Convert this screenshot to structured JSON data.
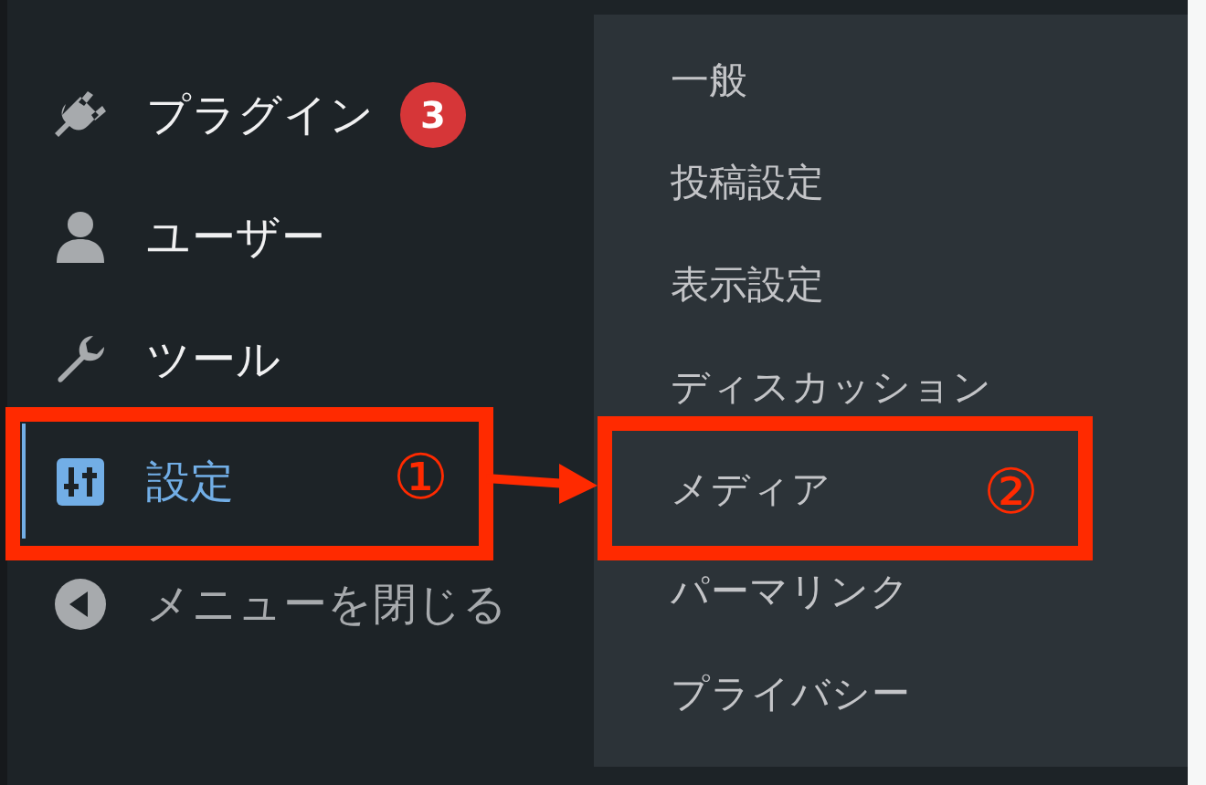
{
  "sidebar": {
    "items": [
      {
        "label": "プラグイン",
        "badge": "3",
        "selected": false
      },
      {
        "label": "ユーザー",
        "selected": false
      },
      {
        "label": "ツール",
        "selected": false
      },
      {
        "label": "設定",
        "selected": true,
        "annotation": "①"
      },
      {
        "label": "メニューを閉じる",
        "selected": false
      }
    ]
  },
  "submenu": {
    "items": [
      {
        "label": "一般",
        "selected": false
      },
      {
        "label": "投稿設定",
        "selected": false
      },
      {
        "label": "表示設定",
        "selected": false
      },
      {
        "label": "ディスカッション",
        "selected": false
      },
      {
        "label": "メディア",
        "selected": false,
        "annotation": "②"
      },
      {
        "label": "パーマリンク",
        "selected": false
      },
      {
        "label": "プライバシー",
        "selected": false
      }
    ]
  }
}
